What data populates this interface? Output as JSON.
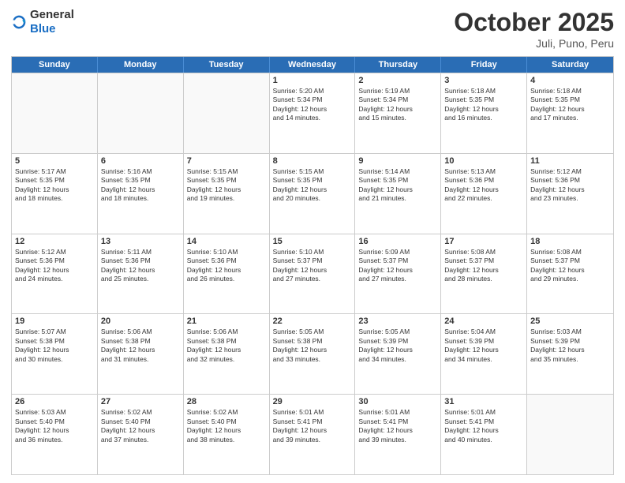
{
  "logo": {
    "general": "General",
    "blue": "Blue"
  },
  "title": "October 2025",
  "location": "Juli, Puno, Peru",
  "weekdays": [
    "Sunday",
    "Monday",
    "Tuesday",
    "Wednesday",
    "Thursday",
    "Friday",
    "Saturday"
  ],
  "weeks": [
    [
      {
        "day": "",
        "text": ""
      },
      {
        "day": "",
        "text": ""
      },
      {
        "day": "",
        "text": ""
      },
      {
        "day": "1",
        "text": "Sunrise: 5:20 AM\nSunset: 5:34 PM\nDaylight: 12 hours\nand 14 minutes."
      },
      {
        "day": "2",
        "text": "Sunrise: 5:19 AM\nSunset: 5:34 PM\nDaylight: 12 hours\nand 15 minutes."
      },
      {
        "day": "3",
        "text": "Sunrise: 5:18 AM\nSunset: 5:35 PM\nDaylight: 12 hours\nand 16 minutes."
      },
      {
        "day": "4",
        "text": "Sunrise: 5:18 AM\nSunset: 5:35 PM\nDaylight: 12 hours\nand 17 minutes."
      }
    ],
    [
      {
        "day": "5",
        "text": "Sunrise: 5:17 AM\nSunset: 5:35 PM\nDaylight: 12 hours\nand 18 minutes."
      },
      {
        "day": "6",
        "text": "Sunrise: 5:16 AM\nSunset: 5:35 PM\nDaylight: 12 hours\nand 18 minutes."
      },
      {
        "day": "7",
        "text": "Sunrise: 5:15 AM\nSunset: 5:35 PM\nDaylight: 12 hours\nand 19 minutes."
      },
      {
        "day": "8",
        "text": "Sunrise: 5:15 AM\nSunset: 5:35 PM\nDaylight: 12 hours\nand 20 minutes."
      },
      {
        "day": "9",
        "text": "Sunrise: 5:14 AM\nSunset: 5:35 PM\nDaylight: 12 hours\nand 21 minutes."
      },
      {
        "day": "10",
        "text": "Sunrise: 5:13 AM\nSunset: 5:36 PM\nDaylight: 12 hours\nand 22 minutes."
      },
      {
        "day": "11",
        "text": "Sunrise: 5:12 AM\nSunset: 5:36 PM\nDaylight: 12 hours\nand 23 minutes."
      }
    ],
    [
      {
        "day": "12",
        "text": "Sunrise: 5:12 AM\nSunset: 5:36 PM\nDaylight: 12 hours\nand 24 minutes."
      },
      {
        "day": "13",
        "text": "Sunrise: 5:11 AM\nSunset: 5:36 PM\nDaylight: 12 hours\nand 25 minutes."
      },
      {
        "day": "14",
        "text": "Sunrise: 5:10 AM\nSunset: 5:36 PM\nDaylight: 12 hours\nand 26 minutes."
      },
      {
        "day": "15",
        "text": "Sunrise: 5:10 AM\nSunset: 5:37 PM\nDaylight: 12 hours\nand 27 minutes."
      },
      {
        "day": "16",
        "text": "Sunrise: 5:09 AM\nSunset: 5:37 PM\nDaylight: 12 hours\nand 27 minutes."
      },
      {
        "day": "17",
        "text": "Sunrise: 5:08 AM\nSunset: 5:37 PM\nDaylight: 12 hours\nand 28 minutes."
      },
      {
        "day": "18",
        "text": "Sunrise: 5:08 AM\nSunset: 5:37 PM\nDaylight: 12 hours\nand 29 minutes."
      }
    ],
    [
      {
        "day": "19",
        "text": "Sunrise: 5:07 AM\nSunset: 5:38 PM\nDaylight: 12 hours\nand 30 minutes."
      },
      {
        "day": "20",
        "text": "Sunrise: 5:06 AM\nSunset: 5:38 PM\nDaylight: 12 hours\nand 31 minutes."
      },
      {
        "day": "21",
        "text": "Sunrise: 5:06 AM\nSunset: 5:38 PM\nDaylight: 12 hours\nand 32 minutes."
      },
      {
        "day": "22",
        "text": "Sunrise: 5:05 AM\nSunset: 5:38 PM\nDaylight: 12 hours\nand 33 minutes."
      },
      {
        "day": "23",
        "text": "Sunrise: 5:05 AM\nSunset: 5:39 PM\nDaylight: 12 hours\nand 34 minutes."
      },
      {
        "day": "24",
        "text": "Sunrise: 5:04 AM\nSunset: 5:39 PM\nDaylight: 12 hours\nand 34 minutes."
      },
      {
        "day": "25",
        "text": "Sunrise: 5:03 AM\nSunset: 5:39 PM\nDaylight: 12 hours\nand 35 minutes."
      }
    ],
    [
      {
        "day": "26",
        "text": "Sunrise: 5:03 AM\nSunset: 5:40 PM\nDaylight: 12 hours\nand 36 minutes."
      },
      {
        "day": "27",
        "text": "Sunrise: 5:02 AM\nSunset: 5:40 PM\nDaylight: 12 hours\nand 37 minutes."
      },
      {
        "day": "28",
        "text": "Sunrise: 5:02 AM\nSunset: 5:40 PM\nDaylight: 12 hours\nand 38 minutes."
      },
      {
        "day": "29",
        "text": "Sunrise: 5:01 AM\nSunset: 5:41 PM\nDaylight: 12 hours\nand 39 minutes."
      },
      {
        "day": "30",
        "text": "Sunrise: 5:01 AM\nSunset: 5:41 PM\nDaylight: 12 hours\nand 39 minutes."
      },
      {
        "day": "31",
        "text": "Sunrise: 5:01 AM\nSunset: 5:41 PM\nDaylight: 12 hours\nand 40 minutes."
      },
      {
        "day": "",
        "text": ""
      }
    ]
  ]
}
